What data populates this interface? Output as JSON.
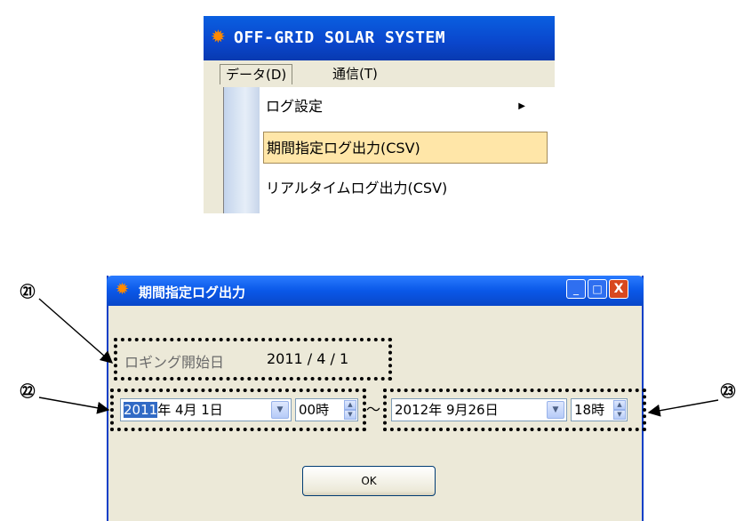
{
  "menu_window": {
    "title": "OFF-GRID SOLAR SYSTEM",
    "menubar": {
      "data": "データ(D)",
      "comm": "通信(T)"
    },
    "items": [
      {
        "label": "ログ設定",
        "has_submenu": true
      },
      {
        "label": "期間指定ログ出力(CSV)",
        "highlighted": true
      },
      {
        "label": "リアルタイムログ出力(CSV)"
      }
    ],
    "submenu_arrow": "▶",
    "icon": "sun-icon"
  },
  "dialog": {
    "title": "期間指定ログ出力",
    "icon": "sun-icon",
    "window_buttons": {
      "minimize": "_",
      "maximize": "□",
      "close": "X"
    },
    "log_start_label": "ロギング開始日",
    "log_start_date": "2011 / 4 / 1",
    "start": {
      "year": "2011",
      "rest": "年  4月  1日",
      "hour": "00時"
    },
    "separator": "〜",
    "end": {
      "date": "2012年  9月26日",
      "hour": "18時"
    },
    "ok_label": "OK",
    "dropdown_glyph": "▼",
    "spin_up": "▲",
    "spin_down": "▼"
  },
  "annotations": {
    "c21": "㉑",
    "c22": "㉒",
    "c23": "㉓"
  },
  "colors": {
    "titlebar": "#0a58e8",
    "menu_highlight": "#ffe6a8",
    "dialog_bg": "#ece9d8",
    "close_button": "#d8481f"
  }
}
